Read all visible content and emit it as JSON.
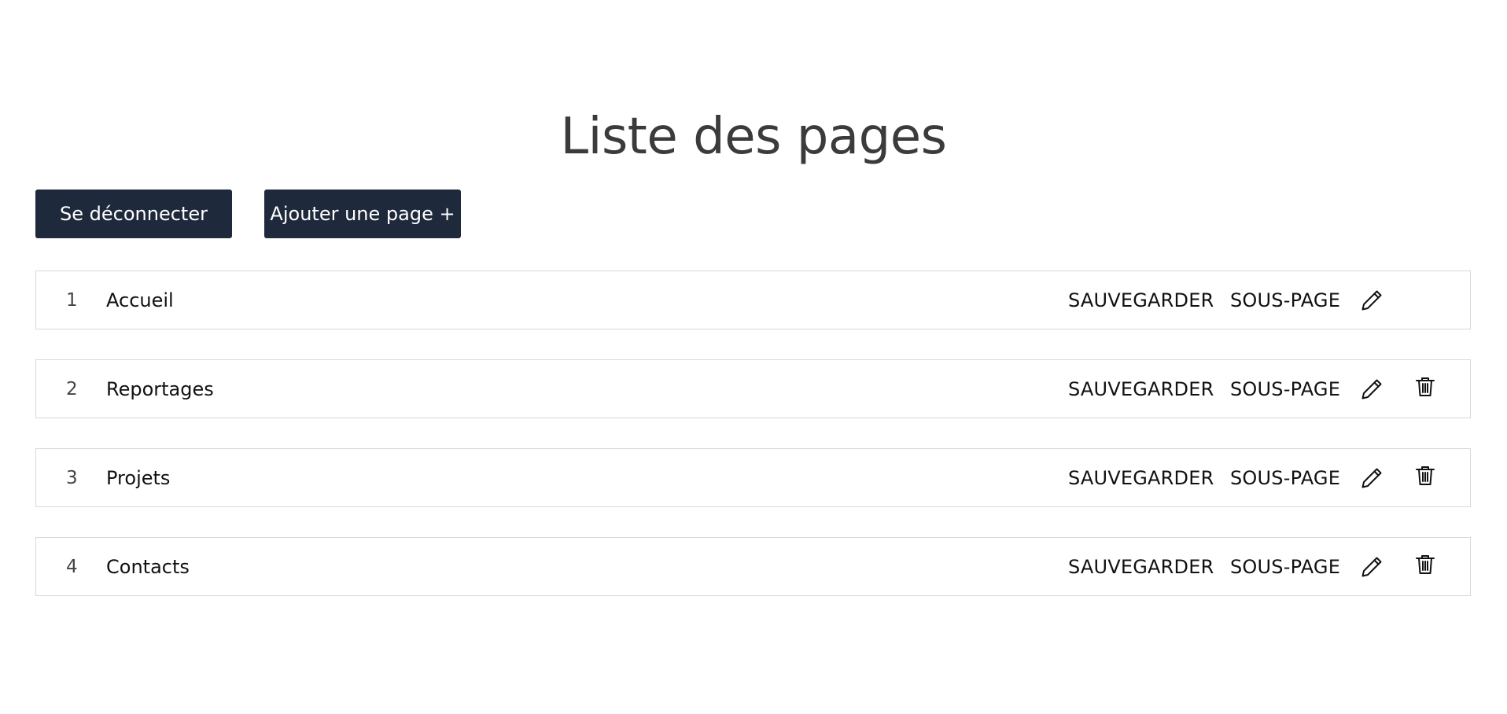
{
  "header": {
    "title": "Liste des pages"
  },
  "toolbar": {
    "logout_label": "Se déconnecter",
    "add_page_label": "Ajouter une page +"
  },
  "pages": [
    {
      "index": "1",
      "title": "Accueil",
      "save_label": "SAUVEGARDER",
      "subpage_label": "SOUS-PAGE",
      "edit_icon": "pencil-icon",
      "has_delete": false
    },
    {
      "index": "2",
      "title": "Reportages",
      "save_label": "SAUVEGARDER",
      "subpage_label": "SOUS-PAGE",
      "edit_icon": "pencil-icon",
      "has_delete": true,
      "delete_icon": "trash-icon"
    },
    {
      "index": "3",
      "title": "Projets",
      "save_label": "SAUVEGARDER",
      "subpage_label": "SOUS-PAGE",
      "edit_icon": "pencil-icon",
      "has_delete": true,
      "delete_icon": "trash-icon"
    },
    {
      "index": "4",
      "title": "Contacts",
      "save_label": "SAUVEGARDER",
      "subpage_label": "SOUS-PAGE",
      "edit_icon": "pencil-icon",
      "has_delete": true,
      "delete_icon": "trash-icon"
    }
  ],
  "colors": {
    "button_bg": "#1e293b",
    "button_text": "#ffffff",
    "row_border": "#d9d9d9",
    "title_text": "#3b3b3b"
  }
}
